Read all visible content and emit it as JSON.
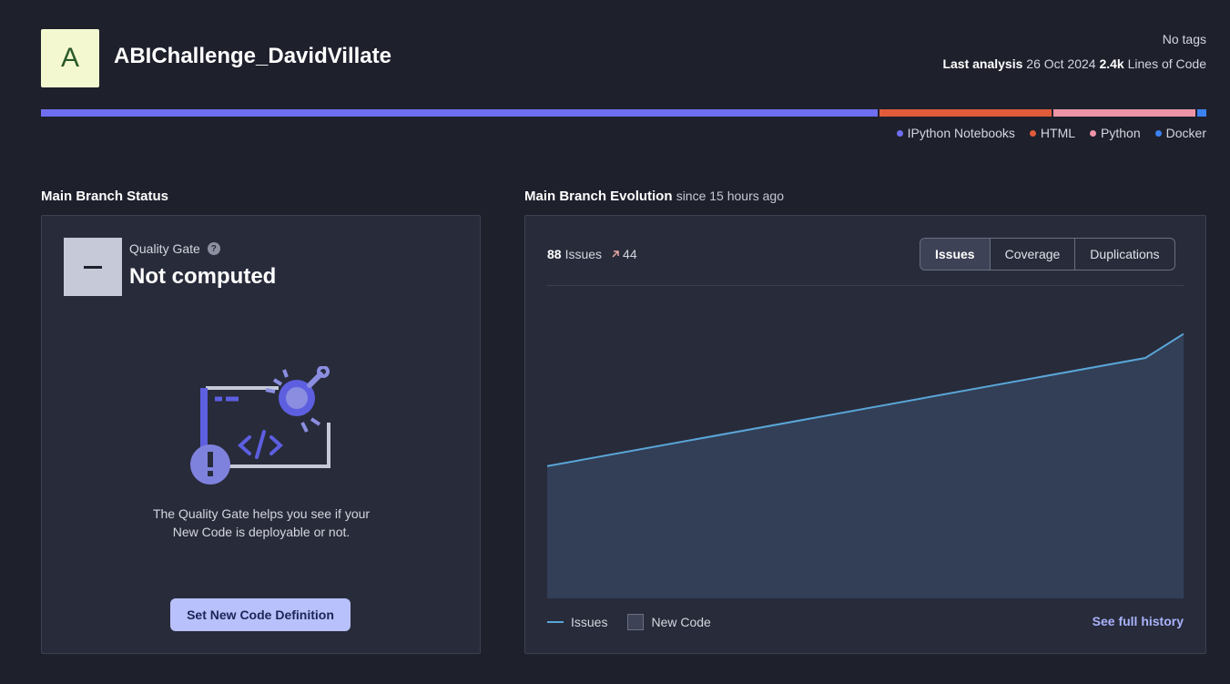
{
  "project": {
    "avatar_letter": "A",
    "name": "ABIChallenge_DavidVillate",
    "tags_text": "No tags",
    "last_analysis_label": "Last analysis",
    "last_analysis_date": "26 Oct 2024",
    "loc_value": "2.4k",
    "loc_label": "Lines of Code"
  },
  "languages": [
    {
      "name": "IPython Notebooks",
      "share": 72.1,
      "color": "#6f6ef0"
    },
    {
      "name": "HTML",
      "share": 14.9,
      "color": "#e05c3a"
    },
    {
      "name": "Python",
      "share": 12.2,
      "color": "#ee94a6"
    },
    {
      "name": "Docker",
      "share": 0.8,
      "color": "#3b82f0"
    }
  ],
  "status_section": {
    "title": "Main Branch Status",
    "quality_gate_label": "Quality Gate",
    "help_glyph": "?",
    "quality_gate_status": "Not computed",
    "description": "The Quality Gate helps you see if your New Code is deployable or not.",
    "button_label": "Set New Code Definition"
  },
  "evolution_section": {
    "title": "Main Branch Evolution",
    "since": "since 15 hours ago",
    "issues_count": "88",
    "issues_label": "Issues",
    "delta_icon": "arrow-up-right-icon",
    "delta_value": "44",
    "tabs": [
      {
        "label": "Issues",
        "active": true
      },
      {
        "label": "Coverage",
        "active": false
      },
      {
        "label": "Duplications",
        "active": false
      }
    ],
    "legend_issues": "Issues",
    "legend_new_code": "New Code",
    "history_link": "See full history"
  },
  "chart_data": {
    "type": "area",
    "series": [
      {
        "name": "Issues",
        "color": "#5aa6d8",
        "fill": "#323f57",
        "points": [
          [
            0,
            44
          ],
          [
            0.94,
            80
          ],
          [
            1,
            88
          ]
        ]
      }
    ],
    "ylim": [
      0,
      100
    ],
    "xlim": [
      0,
      1
    ],
    "grid": false
  }
}
